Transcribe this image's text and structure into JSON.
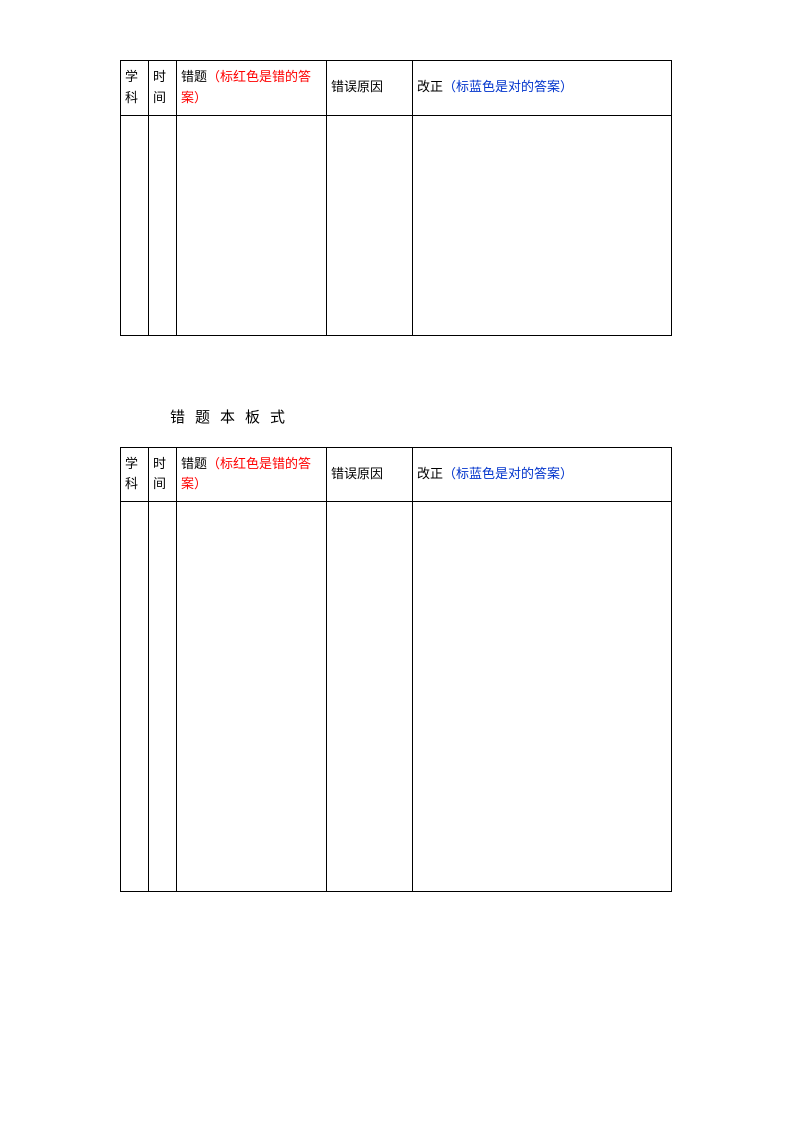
{
  "headers": {
    "subject": "学科",
    "time": "时间",
    "wrong_prefix": "错题",
    "wrong_red": "（标红色是错的答案）",
    "reason": "错误原因",
    "correct_prefix": "改正",
    "correct_blue": "（标蓝色是对的答案）"
  },
  "section_title": "错题本板式",
  "table1": {
    "rows": [
      {
        "subject": "",
        "time": "",
        "wrong": "",
        "reason": "",
        "correct": ""
      }
    ]
  },
  "table2": {
    "rows": [
      {
        "subject": "",
        "time": "",
        "wrong": "",
        "reason": "",
        "correct": ""
      }
    ]
  }
}
